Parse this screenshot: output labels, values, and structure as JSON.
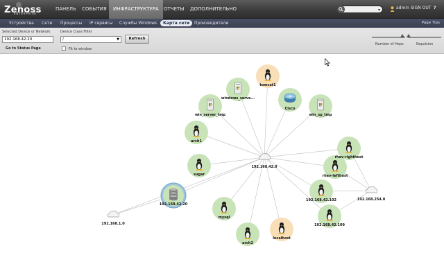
{
  "app": {
    "logo_text": "Zenoss",
    "logo_sub": "ENTERPRISE"
  },
  "nav": {
    "items": [
      {
        "label": "ПАНЕЛЬ"
      },
      {
        "label": "СОБЫТИЯ"
      },
      {
        "label": "ИНФРАСТРУКТУРА"
      },
      {
        "label": "ОТЧЕТЫ"
      },
      {
        "label": "ДОПОЛНИТЕЛЬНО"
      }
    ],
    "active_index": 2
  },
  "user": {
    "name": "admin",
    "sign_out": "SIGN OUT",
    "help": "?"
  },
  "subnav": {
    "items": [
      {
        "label": "Устройства"
      },
      {
        "label": "Сети"
      },
      {
        "label": "Процессы"
      },
      {
        "label": "IP сервисы"
      },
      {
        "label": "Службы Windows"
      },
      {
        "label": "Карта сети"
      },
      {
        "label": "Производители"
      }
    ],
    "active_index": 5,
    "page_tips": "Page Tips"
  },
  "controls": {
    "device_label": "Selected Device or Network",
    "device_value": "192.168.42.20",
    "status_link": "Go to Status Page",
    "class_filter_label": "Device Class Filter",
    "class_filter_value": "/",
    "refresh_label": "Refresh",
    "fit_label": "Fit to window",
    "fit_checked": false,
    "hops_label": "Number of Hops",
    "repulsion_label": "Repulsion",
    "hops_level": 0.5,
    "repulsion_level": 0.1
  },
  "map": {
    "hub_label": "192.168.42.0",
    "network_nodes": [
      {
        "label": "192.168.1.0"
      },
      {
        "label": "192.168.254.0"
      }
    ],
    "devices": [
      {
        "label": "tomcat1",
        "icon": "linux-penguin-icon",
        "state": "warning"
      },
      {
        "label": "windows_serve...",
        "icon": "windows-server-icon",
        "state": "ok"
      },
      {
        "label": "Cisco",
        "icon": "cisco-router-icon",
        "state": "ok"
      },
      {
        "label": "win_server_tmp",
        "icon": "windows-server-icon",
        "state": "ok"
      },
      {
        "label": "win_xp_tmp",
        "icon": "windows-server-icon",
        "state": "ok"
      },
      {
        "label": "arch1",
        "icon": "linux-penguin-icon",
        "state": "ok"
      },
      {
        "label": "rhev-righthost",
        "icon": "linux-penguin-icon",
        "state": "ok"
      },
      {
        "label": "sugar",
        "icon": "linux-penguin-icon",
        "state": "ok"
      },
      {
        "label": "rhev-lefthost",
        "icon": "linux-penguin-icon",
        "state": "ok"
      },
      {
        "label": "192.168.42.20",
        "icon": "storage-database-icon",
        "state": "selected"
      },
      {
        "label": "192.168.42.102",
        "icon": "linux-penguin-icon",
        "state": "ok"
      },
      {
        "label": "mysql",
        "icon": "linux-penguin-icon",
        "state": "ok"
      },
      {
        "label": "192.168.42.109",
        "icon": "linux-penguin-icon",
        "state": "ok"
      },
      {
        "label": "arch2",
        "icon": "linux-penguin-icon",
        "state": "ok"
      },
      {
        "label": "localhost",
        "icon": "linux-penguin-icon",
        "state": "warning"
      }
    ]
  },
  "colors": {
    "ok_node": "#c8e3b8",
    "warning_node": "#f8dfb8",
    "selected_node": "#9ec5dc",
    "edge": "#c8c8c8"
  }
}
